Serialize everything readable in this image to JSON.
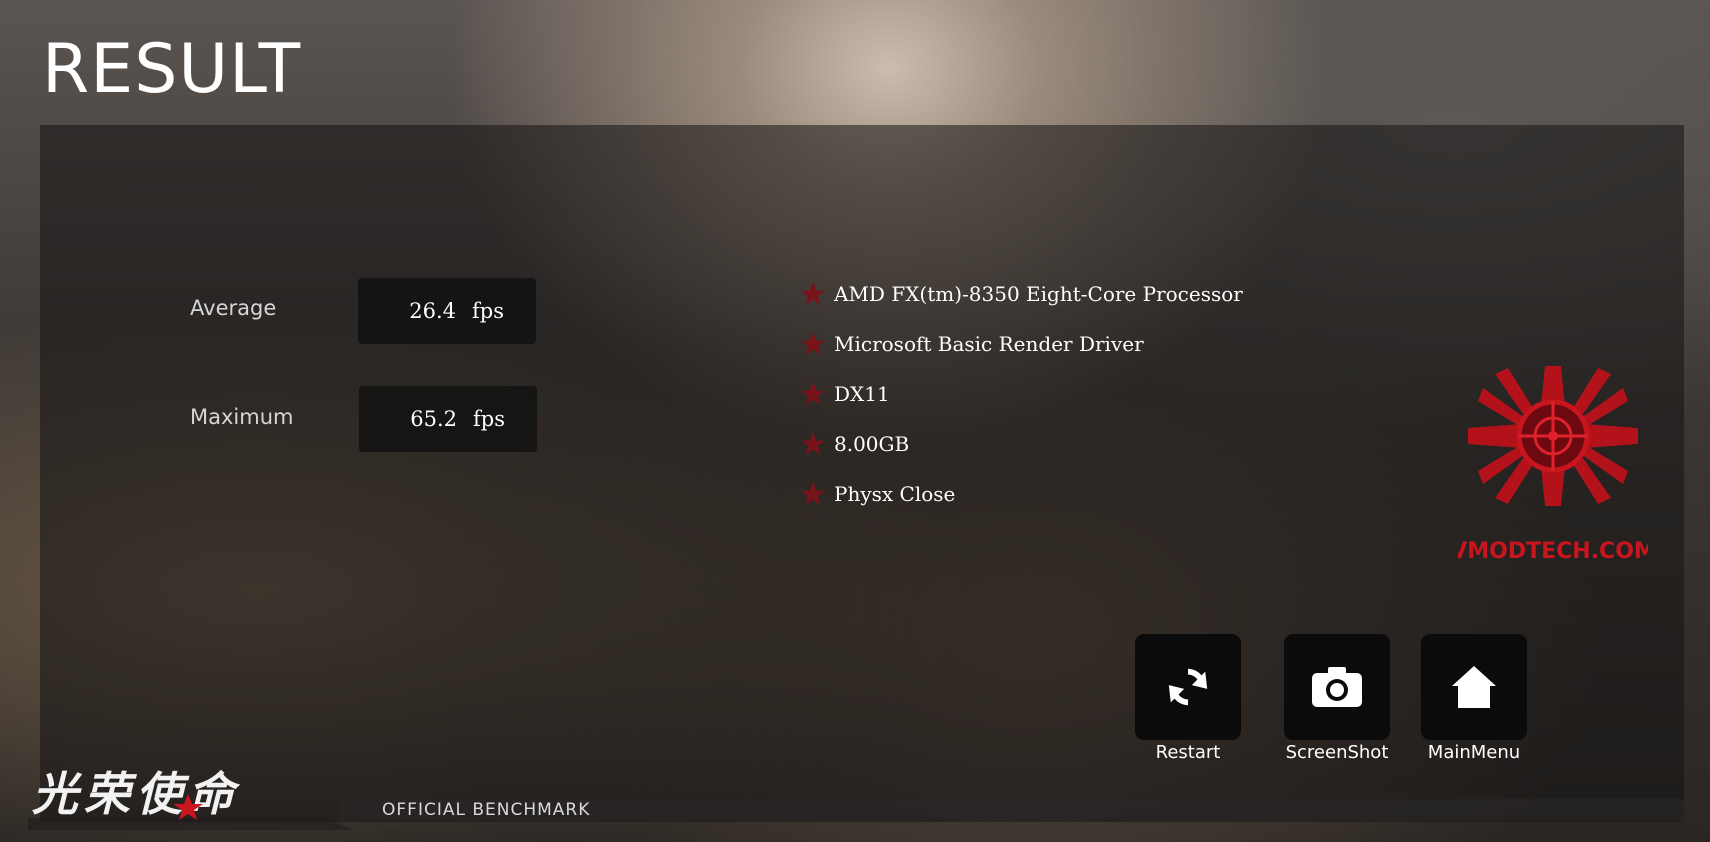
{
  "title": "RESULT",
  "stats": {
    "average": {
      "label": "Average",
      "value": "26.4",
      "unit": "fps"
    },
    "maximum": {
      "label": "Maximum",
      "value": "65.2",
      "unit": "fps"
    }
  },
  "specs": [
    "AMD FX(tm)-8350 Eight-Core Processor",
    "Microsoft Basic Render Driver",
    "DX11",
    "8.00GB",
    "Physx Close"
  ],
  "buttons": {
    "restart": "Restart",
    "screenshot": "ScreenShot",
    "mainmenu": "MainMenu"
  },
  "footer": {
    "game_logo_text": "光荣使命",
    "benchmark_label": "OFFICIAL BENCHMARK"
  },
  "watermark": {
    "text": "VMODTECH.COM"
  },
  "colors": {
    "accent_red": "#b3121a",
    "star_red": "#7a1219",
    "button_bg": "#0b0b0b"
  },
  "icons": [
    "restart-icon",
    "camera-icon",
    "home-icon",
    "star-icon"
  ]
}
